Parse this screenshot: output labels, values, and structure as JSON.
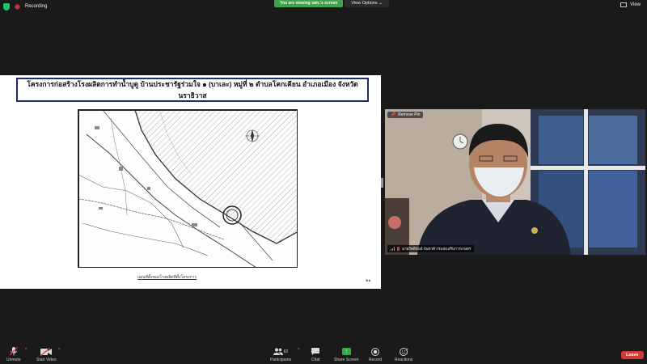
{
  "topbar": {
    "recording_label": "Recording",
    "share_banner": "You are viewing นพร.'s screen",
    "view_options": "View Options",
    "view_label": "View"
  },
  "shared_screen": {
    "slide_title": "โครงการก่อสร้างโรงผลิตการทำน้ำบูดู บ้านประชารัฐร่วมใจ ๑ (บาเละ) หมู่ที่ ๒ ตำบลโคกเคียน อำเภอเมือง จังหวัดนราธิวาส",
    "map_caption": "แผนที่ตั้งของโรงผลิตที่ตั้งโครงการ",
    "page_number": "๒๑"
  },
  "video": {
    "remove_pin": "Remove Pin",
    "participant_name": "นายกิตติพันธ์ จันทวดี กรมส่งเสริมการเกษตร"
  },
  "toolbar": {
    "unmute": "Unmute",
    "start_video": "Start Video",
    "participants": "Participants",
    "participants_count": "62",
    "chat": "Chat",
    "share_screen": "Share Screen",
    "record": "Record",
    "reactions": "Reactions",
    "leave": "Leave"
  },
  "colors": {
    "share_green": "#3fa34d",
    "leave_red": "#d23a3a",
    "slide_border": "#1f2d6b"
  }
}
